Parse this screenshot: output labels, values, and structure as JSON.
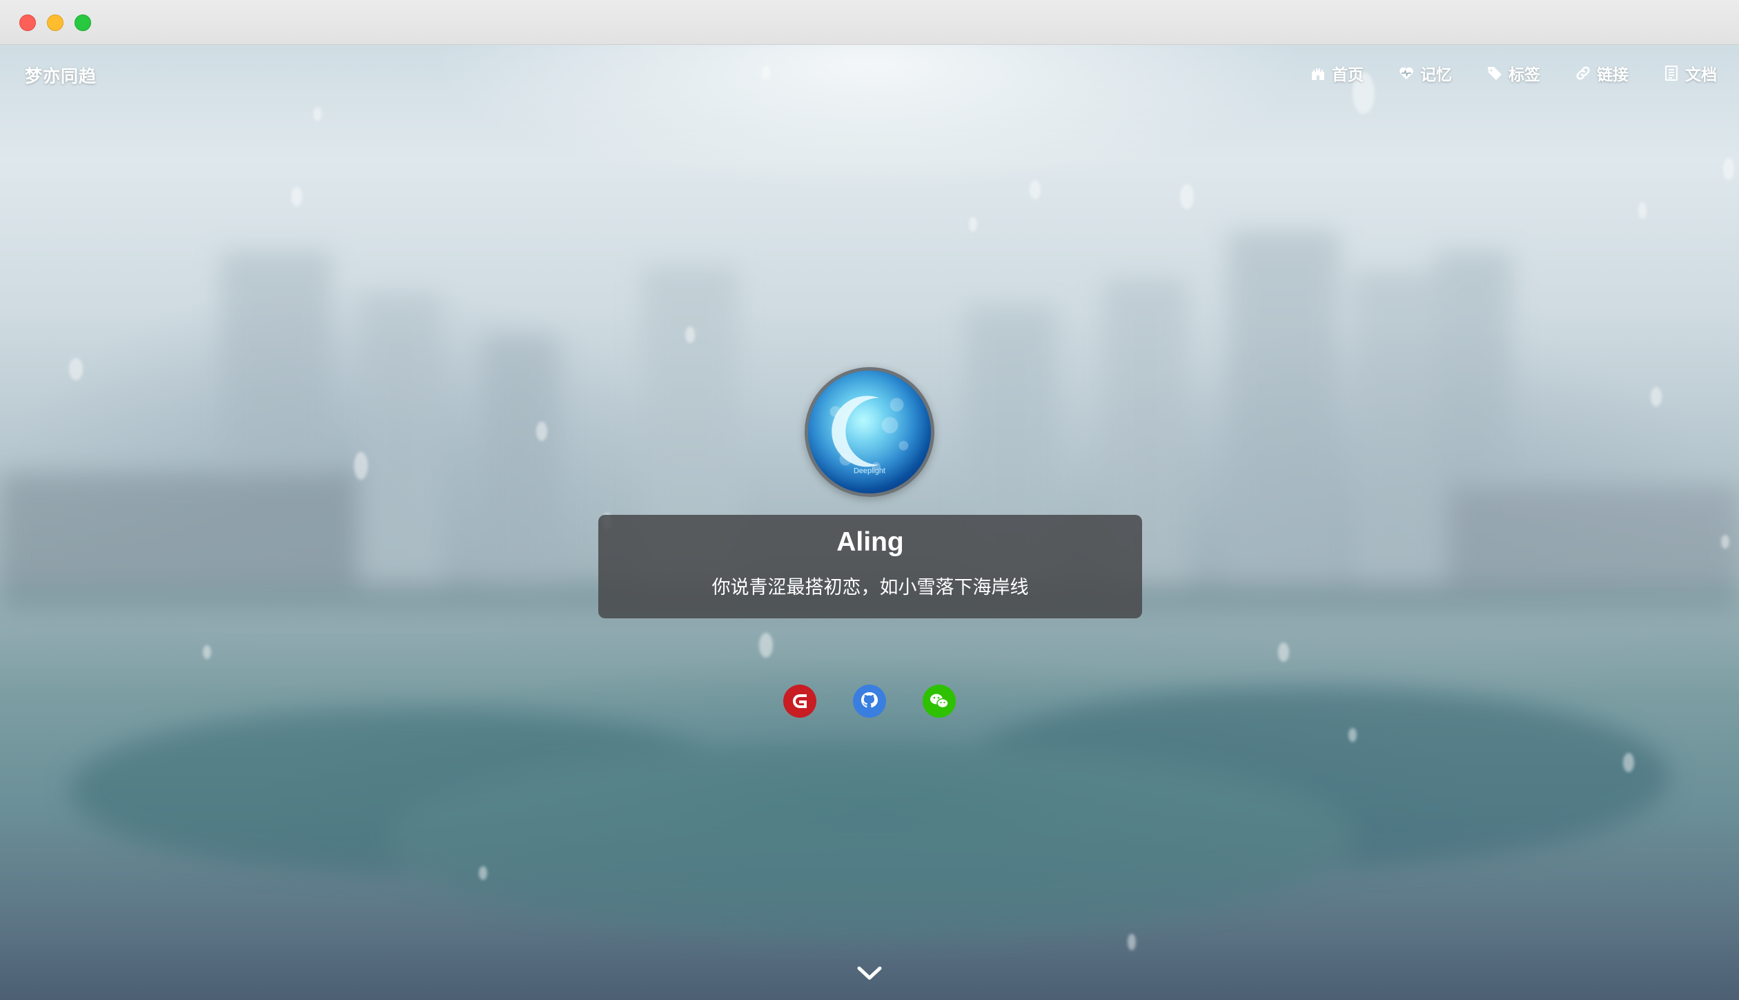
{
  "site": {
    "brand": "梦亦同趋"
  },
  "nav": {
    "items": [
      {
        "label": "首页",
        "icon": "castle-icon"
      },
      {
        "label": "记忆",
        "icon": "heartbeat-icon"
      },
      {
        "label": "标签",
        "icon": "tag-icon"
      },
      {
        "label": "链接",
        "icon": "link-icon"
      },
      {
        "label": "文档",
        "icon": "document-icon"
      }
    ]
  },
  "profile": {
    "name": "Aling",
    "motto": "你说青涩最搭初恋，如小雪落下海岸线",
    "avatar_caption": "Deeplight"
  },
  "social": {
    "items": [
      {
        "icon": "gitee-icon",
        "color": "#c71d23"
      },
      {
        "icon": "github-icon",
        "color": "#3a7ee0"
      },
      {
        "icon": "wechat-icon",
        "color": "#2dc100"
      }
    ]
  },
  "scroll": {
    "icon": "chevron-down-icon"
  }
}
